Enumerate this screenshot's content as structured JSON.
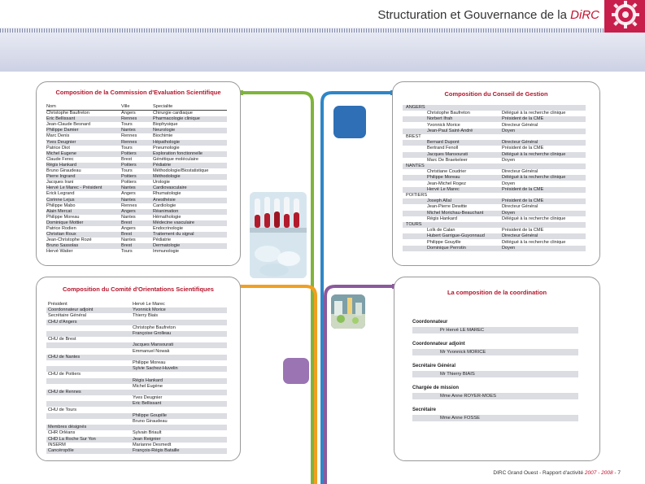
{
  "header": {
    "title": "Structuration et Gouvernance de la ",
    "title_accent": "DiRC"
  },
  "colors": {
    "accent_red": "#c4122f",
    "line_green": "#7fb43b",
    "line_blue": "#2e86c8",
    "line_orange": "#f0a020",
    "line_purple": "#8a5a9c"
  },
  "cse": {
    "title": "Composition de  la Commission d'Evaluation Scientifique",
    "headers": [
      "Nom",
      "Ville",
      "Specialite"
    ],
    "rows": [
      [
        "Christophe Baufreton",
        "Angers",
        "Chirurgie cardiaque"
      ],
      [
        "Eric Bellissant",
        "Rennes",
        "Pharmacologie clinique"
      ],
      [
        "Jean-Claude Besnard",
        "Tours",
        "Biophysique"
      ],
      [
        "Philippe Damier",
        "Nantes",
        "Neurologie"
      ],
      [
        "Marc Denis",
        "Rennes",
        "Biochimie"
      ],
      [
        "Yves Deugnier",
        "Rennes",
        "Hépathologie"
      ],
      [
        "Patrice Diot",
        "Tours",
        "Pneumologie"
      ],
      [
        "Michel Eugene",
        "Poitiers",
        "Exploration fonctionnelle"
      ],
      [
        "Claude Ferec",
        "Brest",
        "Génétique moléculaire"
      ],
      [
        "Régis Hankard",
        "Poitiers",
        "Pédiatrie"
      ],
      [
        "Bruno Giraudeau",
        "Tours",
        "Méthodologie/Biostatistique"
      ],
      [
        "Pierre Ingrand",
        "Poitiers",
        "Méthodologie"
      ],
      [
        "Jacques Irani",
        "Poitiers",
        "Urologie"
      ],
      [
        "Hervé Le Marec - Président",
        "Nantes",
        "Cardiovasculaire"
      ],
      [
        "Erick Legrand",
        "Angers",
        "Rhumatologie"
      ],
      [
        "Corinne Lejus",
        "Nantes",
        "Anesthésie"
      ],
      [
        "Philippe Mabo",
        "Rennes",
        "Cardiologie"
      ],
      [
        "Alain Mercat",
        "Angers",
        "Réanimation"
      ],
      [
        "Philippe Moreau",
        "Nantes",
        "Hémathologie"
      ],
      [
        "Dominique Mottier",
        "Brest",
        "Médecine vasculaire"
      ],
      [
        "Patrice Rodien",
        "Angers",
        "Endocrinologie"
      ],
      [
        "Christian Roux",
        "Brest",
        "Traitement du signal"
      ],
      [
        "Jean-Christophe Rozé",
        "Nantes",
        "Pédiatrie"
      ],
      [
        "Bruno Sassolas",
        "Brest",
        "Dermatologie"
      ],
      [
        "Hervé Watier",
        "Tours",
        "Immunologie"
      ]
    ]
  },
  "cg": {
    "title": "Composition du Conseil de Gestion",
    "rows": [
      [
        "ANGERS",
        "",
        ""
      ],
      [
        "",
        "Christophe Baufreton",
        "Délégué à la recherche clinique"
      ],
      [
        "",
        "Norbert Ifrah",
        "Président de la CME"
      ],
      [
        "",
        "Yvonnick Morice",
        "Directeur Général"
      ],
      [
        "",
        "Jean-Paul Saint-André",
        "Doyen"
      ],
      [
        "BREST",
        "",
        ""
      ],
      [
        "",
        "Bernard Dupont",
        "Directeur Général"
      ],
      [
        "",
        "Bertrand Fenoll",
        "Président de la CME"
      ],
      [
        "",
        "Jacques Mansourati",
        "Délégué à la recherche clinique"
      ],
      [
        "",
        "Marc De Braekeleer",
        "Doyen"
      ],
      [
        "NANTES",
        "",
        ""
      ],
      [
        "",
        "Christiane Coudrier",
        "Directeur Général"
      ],
      [
        "",
        "Philippe Moreau",
        "Délégué à la recherche clinique"
      ],
      [
        "",
        "Jean-Michel Rogez",
        "Doyen"
      ],
      [
        "",
        "Hervé Le Marec",
        "Président de la CME"
      ],
      [
        "POITIERS",
        "",
        ""
      ],
      [
        "",
        "Joseph Allal",
        "Président de la CME"
      ],
      [
        "",
        "Jean-Pierre Dewitte",
        "Directeur Général"
      ],
      [
        "",
        "Michel Morichau-Beauchant",
        "Doyen"
      ],
      [
        "",
        "Régis Hankard",
        "Délégué à la recherche clinique"
      ],
      [
        "TOURS",
        "",
        ""
      ],
      [
        "",
        "Loïk de Calan",
        "Président de la CME"
      ],
      [
        "",
        "Hubert Garrigue-Guyonnaud",
        "Directeur Général"
      ],
      [
        "",
        "Philippe Gouyille",
        "Délégué à la recherche clinique"
      ],
      [
        "",
        "Dominique Perrotin",
        "Doyen"
      ]
    ]
  },
  "cos": {
    "title": "Composition du  Comité d'Orientations Scientifiques",
    "rows": [
      [
        "Président",
        "Hervé Le Marec"
      ],
      [
        "Coordonnateur adjoint",
        "Yvonnick Morice"
      ],
      [
        "Secrétaire Général",
        "Thierry Biais"
      ],
      [
        "CHU d'Angers",
        ""
      ],
      [
        "",
        "Christophe Baufreton"
      ],
      [
        "",
        "Françoise Grolleau"
      ],
      [
        "CHU de Brest",
        ""
      ],
      [
        "",
        "Jacques Mansourati"
      ],
      [
        "",
        "Emmanuel Nowak"
      ],
      [
        "CHU de Nantes",
        ""
      ],
      [
        "",
        "Philippe Moreau"
      ],
      [
        "",
        "Sylvie Sachez-Huvelin"
      ],
      [
        "CHU de Poitiers",
        ""
      ],
      [
        "",
        "Régis Hankard"
      ],
      [
        "",
        "Michel Eugène"
      ],
      [
        "CHU de Rennes",
        ""
      ],
      [
        "",
        "Yves Deugnier"
      ],
      [
        "",
        "Eric Bellissant"
      ],
      [
        "CHU de Tours",
        ""
      ],
      [
        "",
        "Philippe Goupille"
      ],
      [
        "",
        "Bruno Giraudeau"
      ],
      [
        "Membres désignés",
        ""
      ],
      [
        "CHR Orléans",
        "Sylvain Briault"
      ],
      [
        "CHD La Roche Sur Yon",
        "Jean Reignier"
      ],
      [
        "INSERM",
        "Marianne Desmedt"
      ],
      [
        "Cancéropôle",
        "François-Régis Bataille"
      ]
    ]
  },
  "coord": {
    "title": "La composition de la coordination",
    "items": [
      {
        "role": "Coordonnateur",
        "name": "Pr Hervé LE MAREC"
      },
      {
        "role": "Coordonnateur adjoint",
        "name": "Mr Yvonnick MORICE"
      },
      {
        "role": "Secrétaire Général",
        "name": "Mr Thierry BIAIS"
      },
      {
        "role": "Chargée de mission",
        "name": "Mme Anne ROYER-MOES"
      },
      {
        "role": "Secrétaire",
        "name": "Mme Anne FOSSE"
      }
    ]
  },
  "footer": {
    "text": "DIRC Grand Ouest - Rapport d'activité ",
    "years": "2007 - 2008",
    "page": " - 7"
  }
}
